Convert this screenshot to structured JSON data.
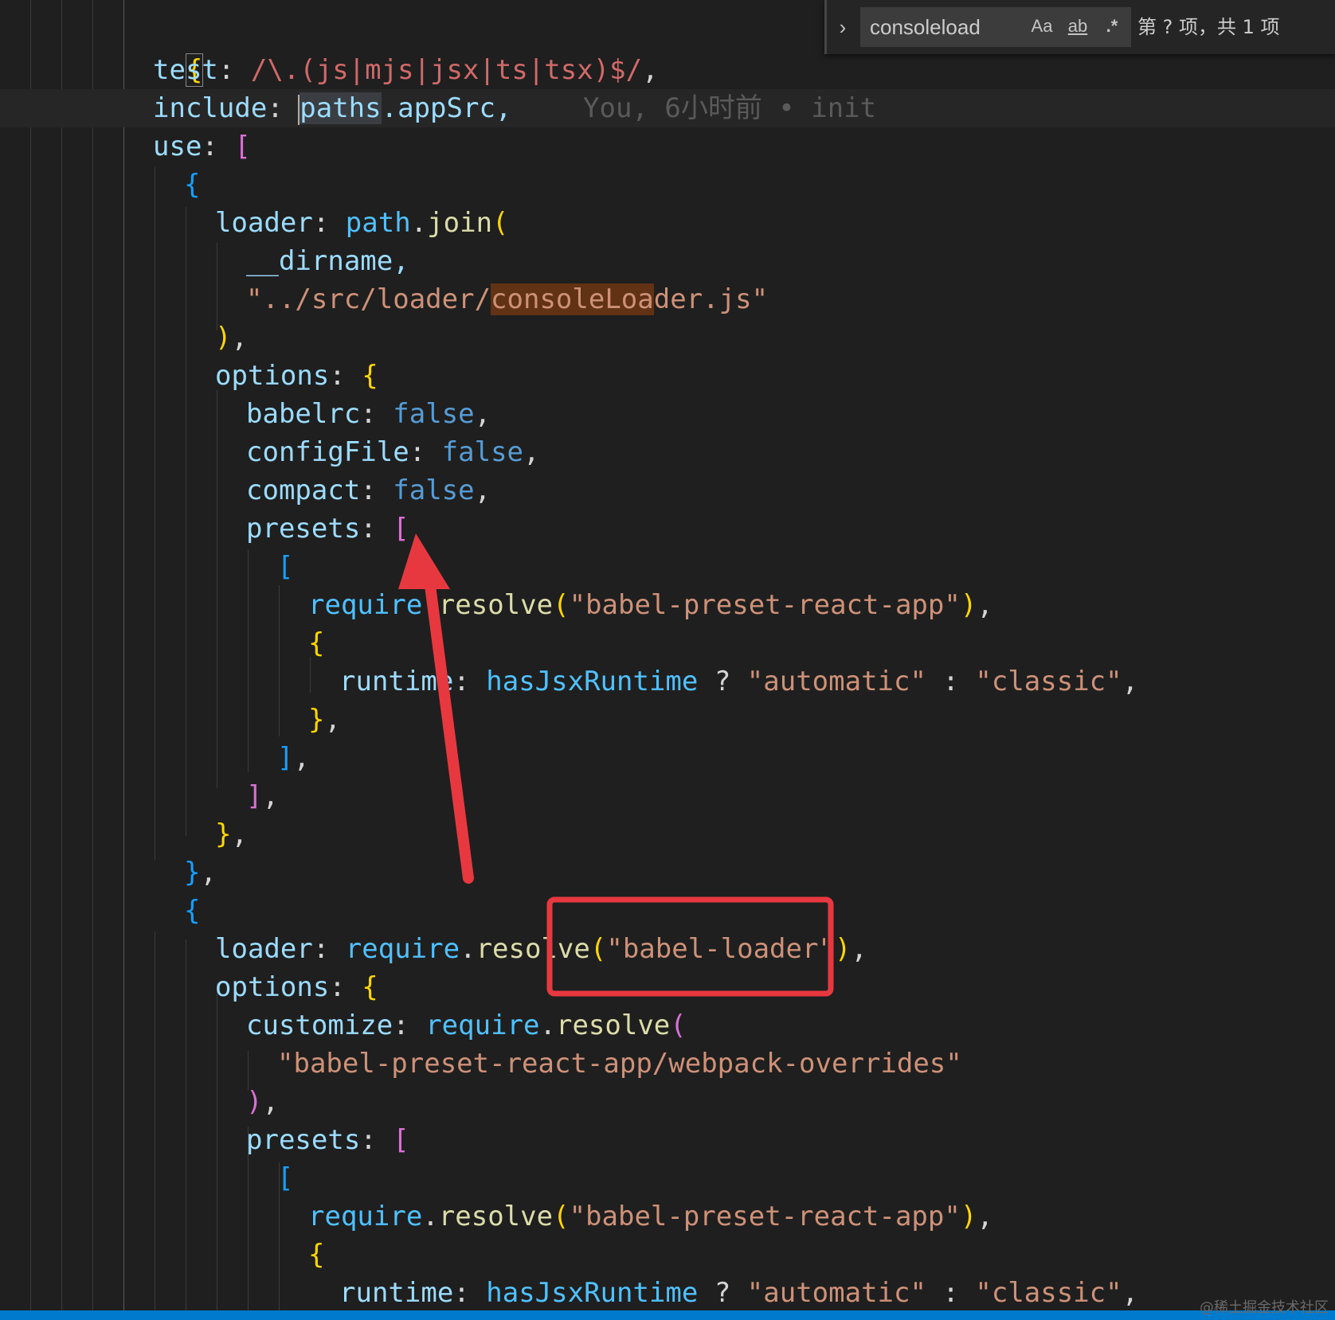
{
  "find": {
    "query": "consoleload",
    "match_case_label": "Aa",
    "whole_word_label": "ab",
    "regex_label": ".*",
    "result_text": "第 ? 项，共 1 项"
  },
  "blame": "You, 6小时前 • init",
  "code": {
    "l1_brace": "{",
    "l2_test_key": "test",
    "l2_regex": "/\\.(js|mjs|jsx|ts|tsx)$/",
    "l3_include_key": "include",
    "l3_paths_a": "p",
    "l3_paths_b": "aths",
    "l3_appsrc": ".appSrc,",
    "l4_use": "use",
    "l5_brace": "{",
    "l6_loader": "loader",
    "l6_path": "path",
    "l6_join": "join",
    "l7_dirname": "__dirname,",
    "l8_str_a": "\"../src/loader/",
    "l8_str_match": "consoleLoa",
    "l8_str_b": "der.js\"",
    "l10_options": "options",
    "l11_babelrc": "babelrc",
    "l12_configfile": "configFile",
    "l13_compact": "compact",
    "false": "false",
    "l14_presets": "presets",
    "require": "require",
    "resolve": "resolve",
    "preset_str": "\"babel-preset-react-app\"",
    "runtime": "runtime",
    "hasjsx": "hasJsxRuntime",
    "automatic": "\"automatic\"",
    "classic": "\"classic\"",
    "loader_str": "\"babel-loader\"",
    "customize": "customize",
    "overrides_str": "\"babel-preset-react-app/webpack-overrides\""
  },
  "watermark": "@稀土掘金技术社区",
  "colors": {
    "accent_red": "#e8383f",
    "status_bar": "#007acc",
    "find_match": "#613214"
  }
}
